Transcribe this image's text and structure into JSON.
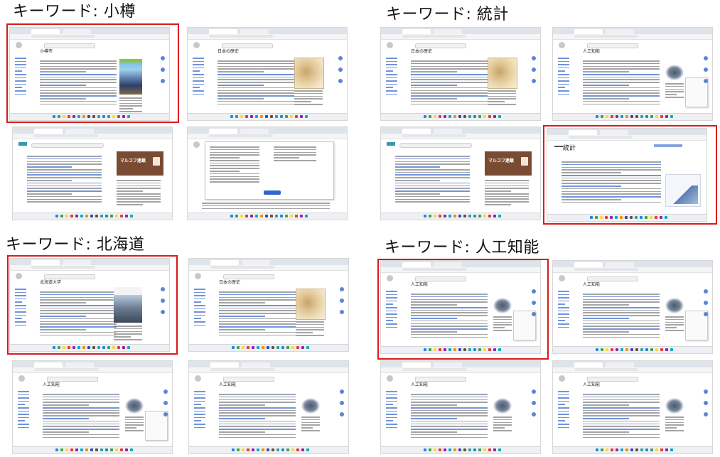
{
  "labels": {
    "otaru": "キーワード: 小樽",
    "toukei": "キーワード: 統計",
    "hokkaido": "キーワード: 北海道",
    "ai": "キーワード: 人工知能"
  },
  "thumb_titles": {
    "otaru": "小樽市",
    "history": "日本の歴史",
    "hokudai": "北海道大学",
    "ai": "人工知能",
    "toukei": "統計",
    "marukoff_banner": "マルコフ連鎖"
  },
  "colors": {
    "selection": "#d81b1b",
    "link": "#3366cc",
    "text": "#222222",
    "background": "#ffffff"
  }
}
